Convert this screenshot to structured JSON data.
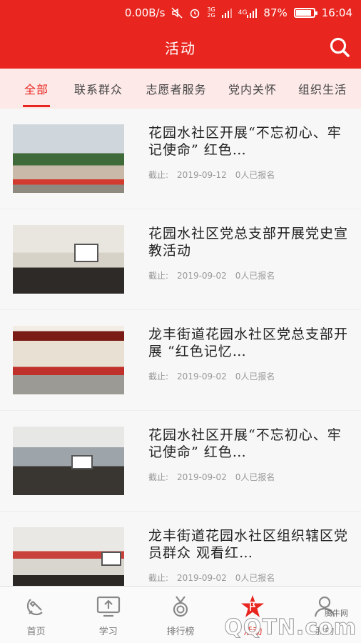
{
  "status_bar": {
    "speed": "0.00B/s",
    "net1": "3G",
    "net2": "2G",
    "net3": "4G",
    "battery": "87%",
    "battery_level": 0.87,
    "time": "16:04"
  },
  "app_bar": {
    "title": "活动"
  },
  "tabs": [
    {
      "label": "全部",
      "active": true
    },
    {
      "label": "联系群众",
      "active": false
    },
    {
      "label": "志愿者服务",
      "active": false
    },
    {
      "label": "党内关怀",
      "active": false
    },
    {
      "label": "组织生活",
      "active": false
    }
  ],
  "activities": [
    {
      "title": "花园水社区开展“不忘初心、牢记使命” 红色…",
      "deadline_label": "截止:",
      "deadline": "2019-09-12",
      "signup": "0人已报名"
    },
    {
      "title": "花园水社区党总支部开展党史宣教活动",
      "deadline_label": "截止:",
      "deadline": "2019-09-02",
      "signup": "0人已报名"
    },
    {
      "title": "龙丰街道花园水社区党总支部开展 “红色记忆…",
      "deadline_label": "截止:",
      "deadline": "2019-09-02",
      "signup": "0人已报名"
    },
    {
      "title": "花园水社区开展“不忘初心、牢记使命” 红色…",
      "deadline_label": "截止:",
      "deadline": "2019-09-02",
      "signup": "0人已报名"
    },
    {
      "title": "龙丰街道花园水社区组织辖区党员群众 观看红…",
      "deadline_label": "截止:",
      "deadline": "2019-09-02",
      "signup": "0人已报名"
    }
  ],
  "tabbar": [
    {
      "label": "首页",
      "icon": "hammer-sickle-icon",
      "active": false
    },
    {
      "label": "学习",
      "icon": "screen-upload-icon",
      "active": false
    },
    {
      "label": "排行榜",
      "icon": "medal-icon",
      "active": false
    },
    {
      "label": "活动",
      "icon": "star-flag-icon",
      "active": true
    },
    {
      "label": "我的",
      "icon": "user-icon",
      "active": false
    }
  ],
  "watermark": {
    "brand": "QQTN.com",
    "sub": "腾牛网"
  },
  "colors": {
    "accent": "#e8261f",
    "tab_bg": "#fce9e8",
    "meta": "#999999"
  }
}
